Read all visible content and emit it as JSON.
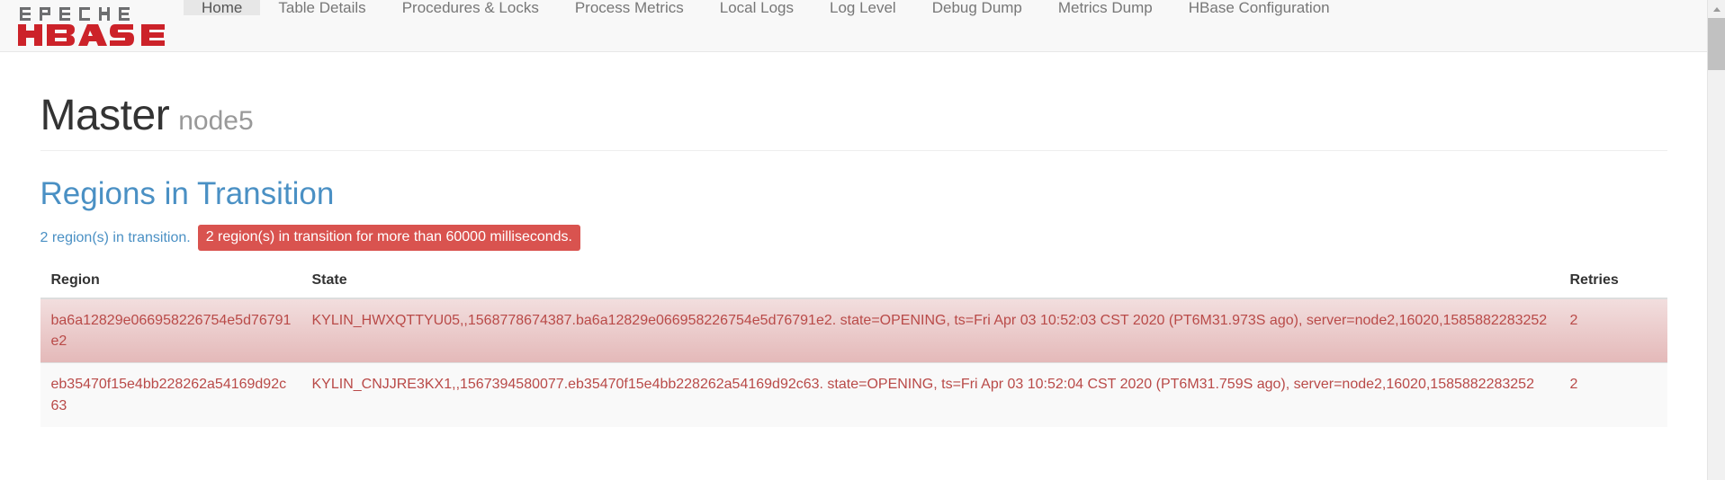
{
  "brand": {
    "top_text": "APACHE",
    "main_text": "HBASE",
    "name": "Apache HBase",
    "red": "#cc2229",
    "gray": "#6d6e70"
  },
  "nav": {
    "items": [
      {
        "label": "Home",
        "active": true
      },
      {
        "label": "Table Details",
        "active": false
      },
      {
        "label": "Procedures & Locks",
        "active": false
      },
      {
        "label": "Process Metrics",
        "active": false
      },
      {
        "label": "Local Logs",
        "active": false
      },
      {
        "label": "Log Level",
        "active": false
      },
      {
        "label": "Debug Dump",
        "active": false
      },
      {
        "label": "Metrics Dump",
        "active": false
      },
      {
        "label": "HBase Configuration",
        "active": false
      }
    ]
  },
  "header": {
    "title": "Master",
    "subtitle": "node5"
  },
  "regions_in_transition": {
    "section_title": "Regions in Transition",
    "status_text": "2 region(s) in transition.",
    "alert_badge": "2 region(s) in transition for more than 60000 milliseconds.",
    "alert_color": "#d9534f",
    "columns": [
      "Region",
      "State",
      "Retries"
    ],
    "rows": [
      {
        "region": "ba6a12829e066958226754e5d76791e2",
        "state": "KYLIN_HWXQTTYU05,,1568778674387.ba6a12829e066958226754e5d76791e2. state=OPENING, ts=Fri Apr 03 10:52:03 CST 2020 (PT6M31.973S ago), server=node2,16020,1585882283252",
        "retries": "2",
        "highlight": true
      },
      {
        "region": "eb35470f15e4bb228262a54169d92c63",
        "state": "KYLIN_CNJJRE3KX1,,1567394580077.eb35470f15e4bb228262a54169d92c63. state=OPENING, ts=Fri Apr 03 10:52:04 CST 2020 (PT6M31.759S ago), server=node2,16020,1585882283252",
        "retries": "2",
        "highlight": false
      }
    ]
  }
}
